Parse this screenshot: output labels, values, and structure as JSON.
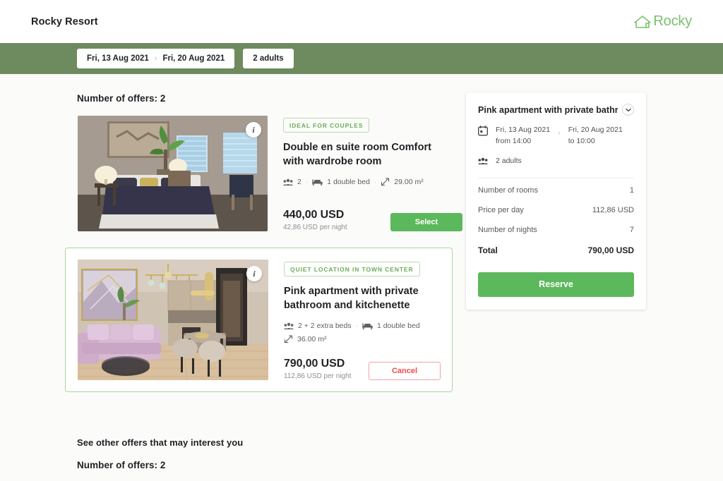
{
  "header": {
    "property_name": "Rocky Resort",
    "logo_text": "Rocky",
    "logo_icon": "house-icon",
    "brand_color": "#7ac16e"
  },
  "search_bar": {
    "background_color": "#6e8b5f",
    "date_pill": {
      "check_in": "Fri, 13 Aug 2021",
      "separator": "›",
      "check_out": "Fri, 20 Aug 2021"
    },
    "guests_pill": "2 adults"
  },
  "main": {
    "offers_count_label": "Number of offers: 2",
    "offers": [
      {
        "tag": "IDEAL FOR COUPLES",
        "title": "Double en suite room Comfort with wardrobe room",
        "info_icon": "info-icon",
        "meta": {
          "guests_icon": "people-icon",
          "guests": "2",
          "bed_icon": "bed-icon",
          "bed": "1 double bed",
          "area_icon": "resize-icon",
          "area": "29.00 m²"
        },
        "price_total": "440,00 USD",
        "price_per_night": "42,86 USD per night",
        "action_label": "Select",
        "action_type": "select",
        "selected": false
      },
      {
        "tag": "QUIET LOCATION IN TOWN CENTER",
        "title": "Pink apartment with private bathroom and kitchenette",
        "info_icon": "info-icon",
        "meta": {
          "guests_icon": "people-icon",
          "guests": "2 + 2 extra beds",
          "bed_icon": "bed-icon",
          "bed": "1 double bed",
          "area_icon": "resize-icon",
          "area": "36.00 m²"
        },
        "price_total": "790,00 USD",
        "price_per_night": "112,86 USD per night",
        "action_label": "Cancel",
        "action_type": "cancel",
        "selected": true
      }
    ]
  },
  "summary": {
    "title": "Pink apartment with private bathroom",
    "dropdown_icon": "chevron-down-icon",
    "calendar_icon": "calendar-icon",
    "guests_icon": "people-icon",
    "check_in_date": "Fri, 13 Aug 2021",
    "check_in_time": "from 14:00",
    "date_separator": "›",
    "check_out_date": "Fri, 20 Aug 2021",
    "check_out_time": "to 10:00",
    "guests": "2 adults",
    "rows": [
      {
        "label": "Number of rooms",
        "value": "1"
      },
      {
        "label": "Price per day",
        "value": "112,86 USD"
      },
      {
        "label": "Number of nights",
        "value": "7"
      }
    ],
    "total_label": "Total",
    "total_value": "790,00 USD",
    "reserve_label": "Reserve",
    "reserve_color": "#5cb85c"
  },
  "bottom": {
    "heading": "See other offers that may interest you",
    "offers_count_label": "Number of offers: 2"
  }
}
